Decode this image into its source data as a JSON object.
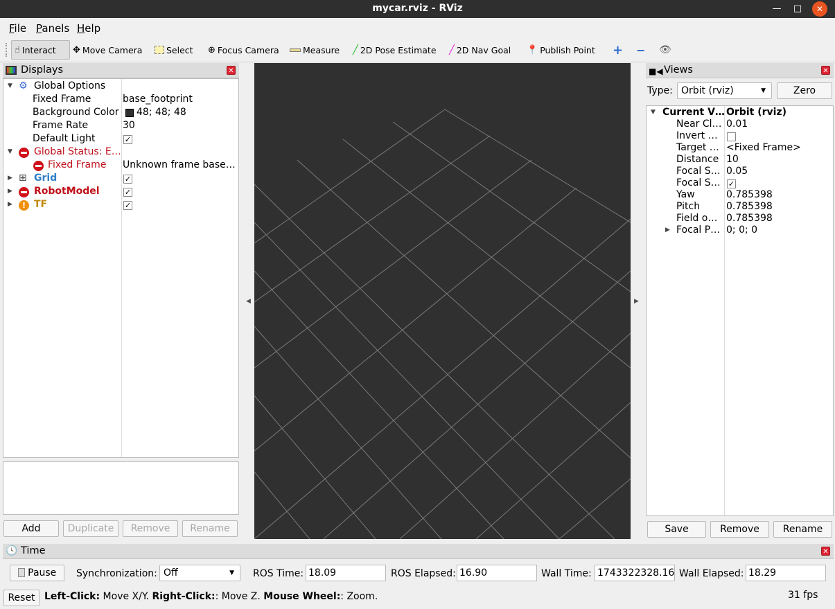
{
  "window": {
    "title": "mycar.rviz - RViz",
    "min": "—",
    "max": "□",
    "close": "✕"
  },
  "menu": {
    "file": "File",
    "panels": "Panels",
    "help": "Help"
  },
  "toolbar": {
    "interact": "Interact",
    "move_camera": "Move Camera",
    "select": "Select",
    "focus_camera": "Focus Camera",
    "measure": "Measure",
    "pose_estimate": "2D Pose Estimate",
    "nav_goal": "2D Nav Goal",
    "publish_point": "Publish Point"
  },
  "displays": {
    "title": "Displays",
    "global_options": "Global Options",
    "fixed_frame_label": "Fixed Frame",
    "fixed_frame_value": "base_footprint",
    "bg_color_label": "Background Color",
    "bg_color_value": "48; 48; 48",
    "bg_color_hex": "#303030",
    "frame_rate_label": "Frame Rate",
    "frame_rate_value": "30",
    "default_light_label": "Default Light",
    "global_status_label": "Global Status: E…",
    "status_fixed_frame_label": "Fixed Frame",
    "status_fixed_frame_value": "Unknown frame base…",
    "grid_label": "Grid",
    "robot_model_label": "RobotModel",
    "tf_label": "TF",
    "buttons": {
      "add": "Add",
      "duplicate": "Duplicate",
      "remove": "Remove",
      "rename": "Rename"
    }
  },
  "views": {
    "title": "Views",
    "type_label": "Type:",
    "type_value": "Orbit (rviz)",
    "zero": "Zero",
    "current_view_label": "Current V…",
    "current_view_value": "Orbit (rviz)",
    "props": [
      {
        "k": "Near Cl…",
        "v": "0.01"
      },
      {
        "k": "Invert …",
        "v": ""
      },
      {
        "k": "Target …",
        "v": "<Fixed Frame>"
      },
      {
        "k": "Distance",
        "v": "10"
      },
      {
        "k": "Focal S…",
        "v": "0.05"
      },
      {
        "k": "Focal S…",
        "v": ""
      },
      {
        "k": "Yaw",
        "v": "0.785398"
      },
      {
        "k": "Pitch",
        "v": "0.785398"
      },
      {
        "k": "Field o…",
        "v": "0.785398"
      },
      {
        "k": "Focal P…",
        "v": "0; 0; 0"
      }
    ],
    "buttons": {
      "save": "Save",
      "remove": "Remove",
      "rename": "Rename"
    }
  },
  "time": {
    "title": "Time",
    "pause": "Pause",
    "sync_label": "Synchronization:",
    "sync_value": "Off",
    "ros_time_label": "ROS Time:",
    "ros_time_value": "18.09",
    "ros_elapsed_label": "ROS Elapsed:",
    "ros_elapsed_value": "16.90",
    "wall_time_label": "Wall Time:",
    "wall_time_value": "1743322328.16",
    "wall_elapsed_label": "Wall Elapsed:",
    "wall_elapsed_value": "18.29"
  },
  "status": {
    "reset": "Reset",
    "left_click": "Left-Click:",
    "left_click_desc": " Move X/Y. ",
    "right_click": "Right-Click:",
    "right_click_desc": ": Move Z. ",
    "wheel": "Mouse Wheel:",
    "wheel_desc": ": Zoom.",
    "fps": "31 fps"
  }
}
